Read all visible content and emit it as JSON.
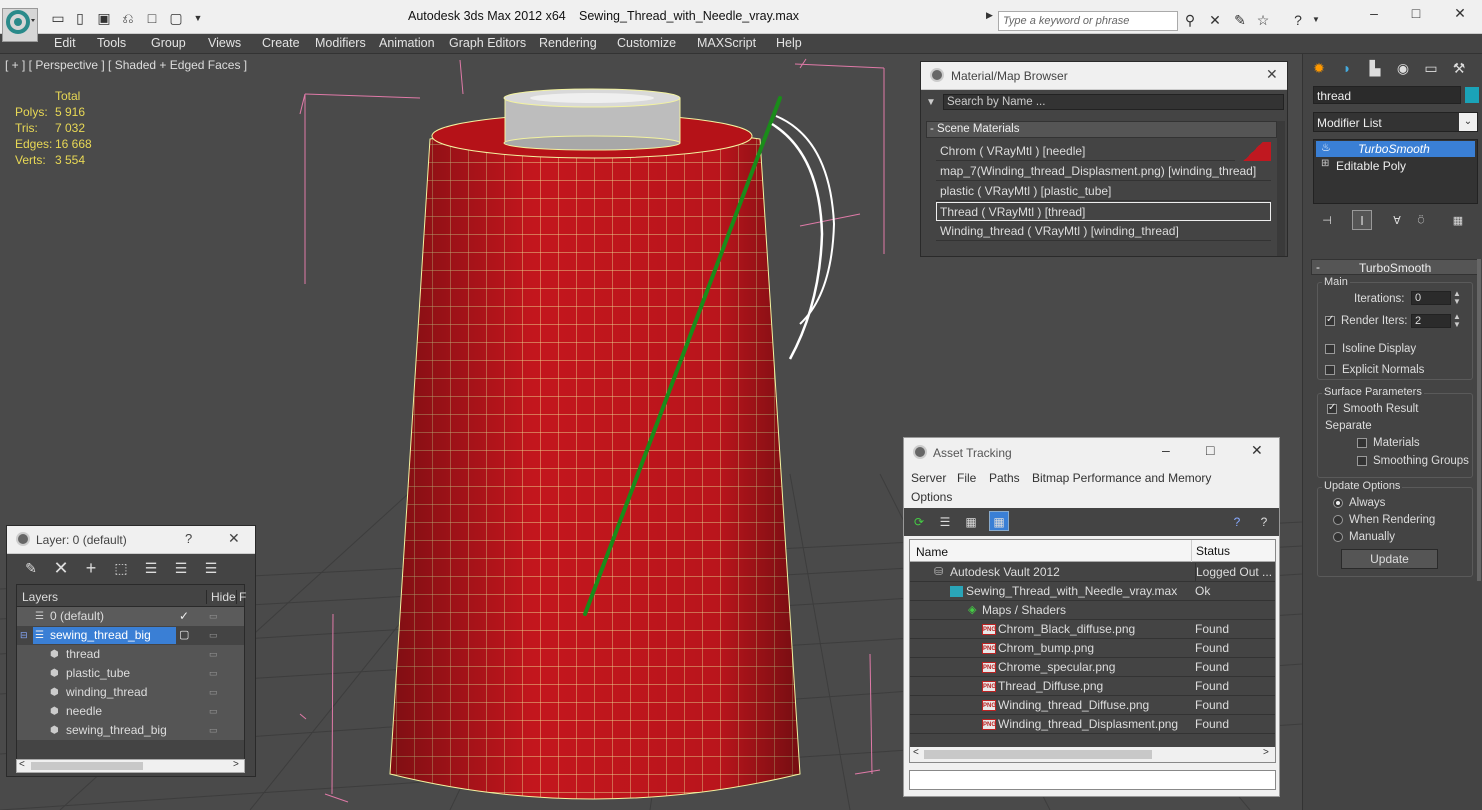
{
  "titlebar": {
    "app": "Autodesk 3ds Max  2012 x64",
    "file": "Sewing_Thread_with_Needle_vray.max",
    "search_placeholder": "Type a keyword or phrase"
  },
  "menu": [
    "Edit",
    "Tools",
    "Group",
    "Views",
    "Create",
    "Modifiers",
    "Animation",
    "Graph Editors",
    "Rendering",
    "Customize",
    "MAXScript",
    "Help"
  ],
  "viewport": {
    "label": "[ + ] [ Perspective ] [ Shaded + Edged Faces ]",
    "stats": {
      "header": "Total",
      "rows": [
        {
          "label": "Polys:",
          "value": "5 916"
        },
        {
          "label": "Tris:",
          "value": "7 032"
        },
        {
          "label": "Edges:",
          "value": "16 668"
        },
        {
          "label": "Verts:",
          "value": "3 554"
        }
      ]
    }
  },
  "material_browser": {
    "title": "Material/Map Browser",
    "search_placeholder": "Search by Name ...",
    "section": "- Scene Materials",
    "items": [
      "Chrom  ( VRayMtl ) [needle]",
      "map_7(Winding_thread_Displasment.png) [winding_thread]",
      "plastic  ( VRayMtl ) [plastic_tube]",
      "Thread  ( VRayMtl ) [thread]",
      "Winding_thread  ( VRayMtl ) [winding_thread]"
    ]
  },
  "layer_panel": {
    "title": "Layer: 0 (default)",
    "help": "?",
    "col_layers": "Layers",
    "col_hide": "Hide",
    "col_f": "F",
    "rows": [
      {
        "name": "0 (default)"
      },
      {
        "name": "sewing_thread_big"
      },
      {
        "name": "thread"
      },
      {
        "name": "plastic_tube"
      },
      {
        "name": "winding_thread"
      },
      {
        "name": "needle"
      },
      {
        "name": "sewing_thread_big"
      }
    ]
  },
  "asset_tracking": {
    "title": "Asset Tracking",
    "menu": [
      "Server",
      "File",
      "Paths",
      "Bitmap Performance and Memory",
      "Options"
    ],
    "col_name": "Name",
    "col_status": "Status",
    "rows": [
      {
        "name": "Autodesk Vault 2012",
        "status": "Logged Out ..."
      },
      {
        "name": "Sewing_Thread_with_Needle_vray.max",
        "status": "Ok"
      },
      {
        "name": "Maps / Shaders",
        "status": ""
      },
      {
        "name": "Chrom_Black_diffuse.png",
        "status": "Found"
      },
      {
        "name": "Chrom_bump.png",
        "status": "Found"
      },
      {
        "name": "Chrome_specular.png",
        "status": "Found"
      },
      {
        "name": "Thread_Diffuse.png",
        "status": "Found"
      },
      {
        "name": "Winding_thread_Diffuse.png",
        "status": "Found"
      },
      {
        "name": "Winding_thread_Displasment.png",
        "status": "Found"
      }
    ]
  },
  "command_panel": {
    "object_name": "thread",
    "object_color": "#1aa3b8",
    "modifier_list": "Modifier List",
    "stack": [
      "TurboSmooth",
      "Editable Poly"
    ],
    "rollout_title": "TurboSmooth",
    "main_label": "Main",
    "iterations_label": "Iterations:",
    "iterations_value": "0",
    "render_iters_label": "Render Iters:",
    "render_iters_value": "2",
    "isoline_display": "Isoline Display",
    "explicit_normals": "Explicit Normals",
    "surface_params": "Surface Parameters",
    "smooth_result": "Smooth Result",
    "separate": "Separate",
    "materials": "Materials",
    "smoothing_groups": "Smoothing Groups",
    "update_options": "Update Options",
    "always": "Always",
    "when_rendering": "When Rendering",
    "manually": "Manually",
    "update_button": "Update"
  },
  "colors": {
    "thread_red": "#c0161c",
    "needle_green": "#1a8c1a",
    "selection_blue": "#3a7fd5"
  }
}
